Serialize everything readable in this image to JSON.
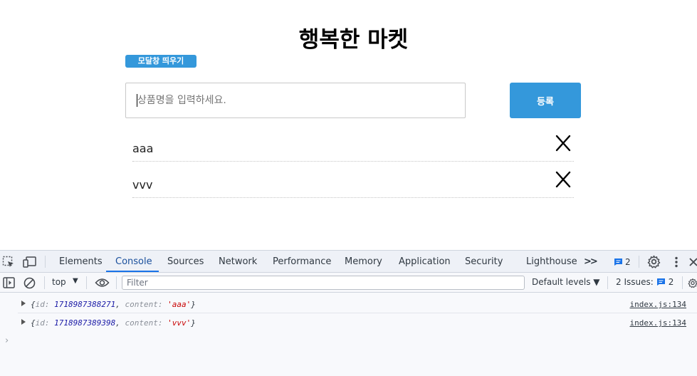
{
  "app": {
    "title": "행복한 마켓",
    "modal_button_label": "모달창 띄우기",
    "input_placeholder": "상품명을 입력하세요.",
    "submit_label": "등록",
    "items": [
      {
        "text": "aaa"
      },
      {
        "text": "vvv"
      }
    ]
  },
  "devtools": {
    "tabs": [
      "Elements",
      "Console",
      "Sources",
      "Network",
      "Performance",
      "Memory",
      "Application",
      "Security",
      "Lighthouse"
    ],
    "more_tabs": ">>",
    "message_count": "2",
    "toolbar": {
      "context": "top",
      "filter_placeholder": "Filter",
      "levels": "Default levels ▼",
      "issues_label": "2 Issues:",
      "issues_count": "2"
    },
    "logs": [
      {
        "id_key": "id",
        "id_val": "1718987388271",
        "content_key": "content",
        "content_val": "'aaa'",
        "source": "index.js:134"
      },
      {
        "id_key": "id",
        "id_val": "1718987389398",
        "content_key": "content",
        "content_val": "'vvv'",
        "source": "index.js:134"
      }
    ],
    "prompt": "›"
  },
  "colors": {
    "accent": "#3498db",
    "devtools_active": "#1a73e8"
  }
}
